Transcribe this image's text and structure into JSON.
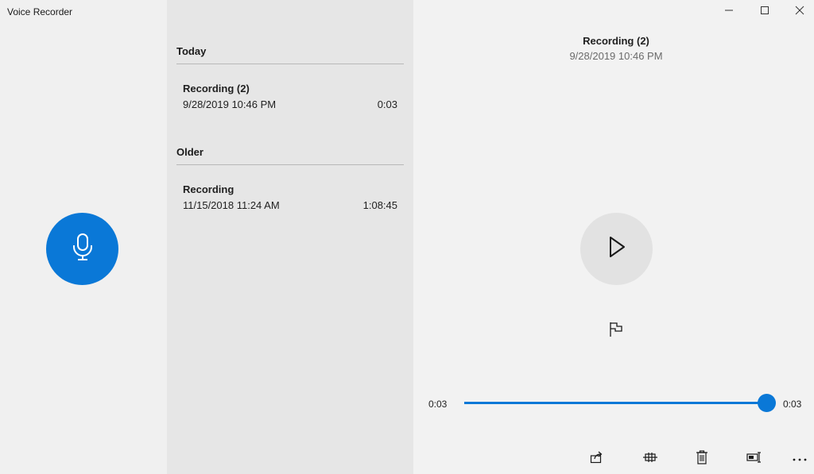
{
  "window": {
    "title": "Voice Recorder",
    "controls": [
      "minimize",
      "maximize",
      "close"
    ]
  },
  "recorder": {
    "record_icon": "microphone-icon",
    "accent": "#0a78d7"
  },
  "list": {
    "groups": [
      {
        "header": "Today",
        "items": [
          {
            "name": "Recording (2)",
            "date": "9/28/2019 10:46 PM",
            "duration": "0:03"
          }
        ]
      },
      {
        "header": "Older",
        "items": [
          {
            "name": "Recording",
            "date": "11/15/2018 11:24 AM",
            "duration": "1:08:45"
          }
        ]
      }
    ]
  },
  "player": {
    "title": "Recording (2)",
    "date": "9/28/2019 10:46 PM",
    "current_time": "0:03",
    "total_time": "0:03",
    "progress": 1.0,
    "play_icon": "play-icon",
    "flag_icon": "flag-icon"
  },
  "toolbar": {
    "items": [
      "share-icon",
      "trim-icon",
      "delete-icon",
      "rename-icon",
      "more-icon"
    ]
  }
}
